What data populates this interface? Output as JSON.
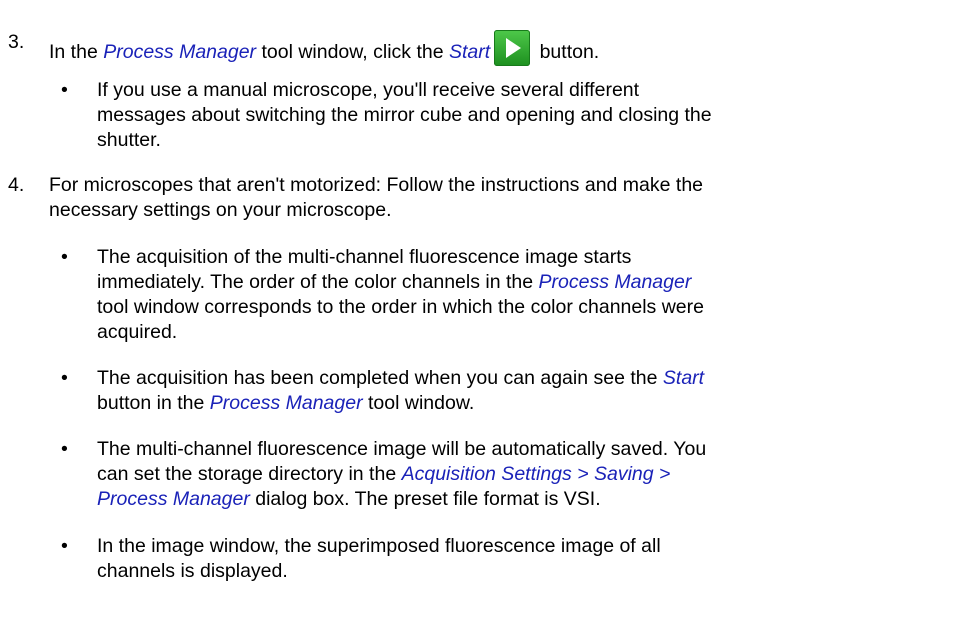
{
  "steps": [
    {
      "number": "3.",
      "before": "In the ",
      "link1": "Process Manager",
      "middle": " tool window, click the ",
      "link2": "Start",
      "after": " button."
    },
    {
      "number": "4.",
      "line1": "For microscopes that aren't motorized: Follow the instructions and make the",
      "line2": "necessary settings on your microscope."
    }
  ],
  "bullets": {
    "b1": {
      "line1": "If you use a manual microscope, you'll receive several different",
      "line2": "messages about switching the mirror cube and opening and closing the",
      "line3": "shutter."
    },
    "b2": {
      "line1": "The acquisition of the multi-channel fluorescence image starts",
      "line2a": "immediately. The order of the color channels in the ",
      "line2link": "Process Manager",
      "line3": "tool window corresponds to the order in which the color channels were",
      "line4": "acquired."
    },
    "b3": {
      "line1a": "The acquisition has been completed when you can again see the ",
      "line1link": "Start",
      "line2a": "button in the ",
      "line2link": "Process Manager",
      "line2b": " tool window."
    },
    "b4": {
      "line1": "The multi-channel fluorescence image will be automatically saved. You",
      "line2a": "can set the storage directory in the ",
      "line2link": "Acquisition Settings > Saving >",
      "line3link": "Process Manager",
      "line3b": " dialog box. The preset file format is VSI."
    },
    "b5": {
      "line1": "In the image window, the superimposed fluorescence image of all",
      "line2": "channels is displayed."
    }
  },
  "bullet_symbol": "•",
  "icons": {
    "start": "start-play-icon"
  },
  "colors": {
    "link": "#1a22b8",
    "start_icon_green": "#34b233"
  }
}
